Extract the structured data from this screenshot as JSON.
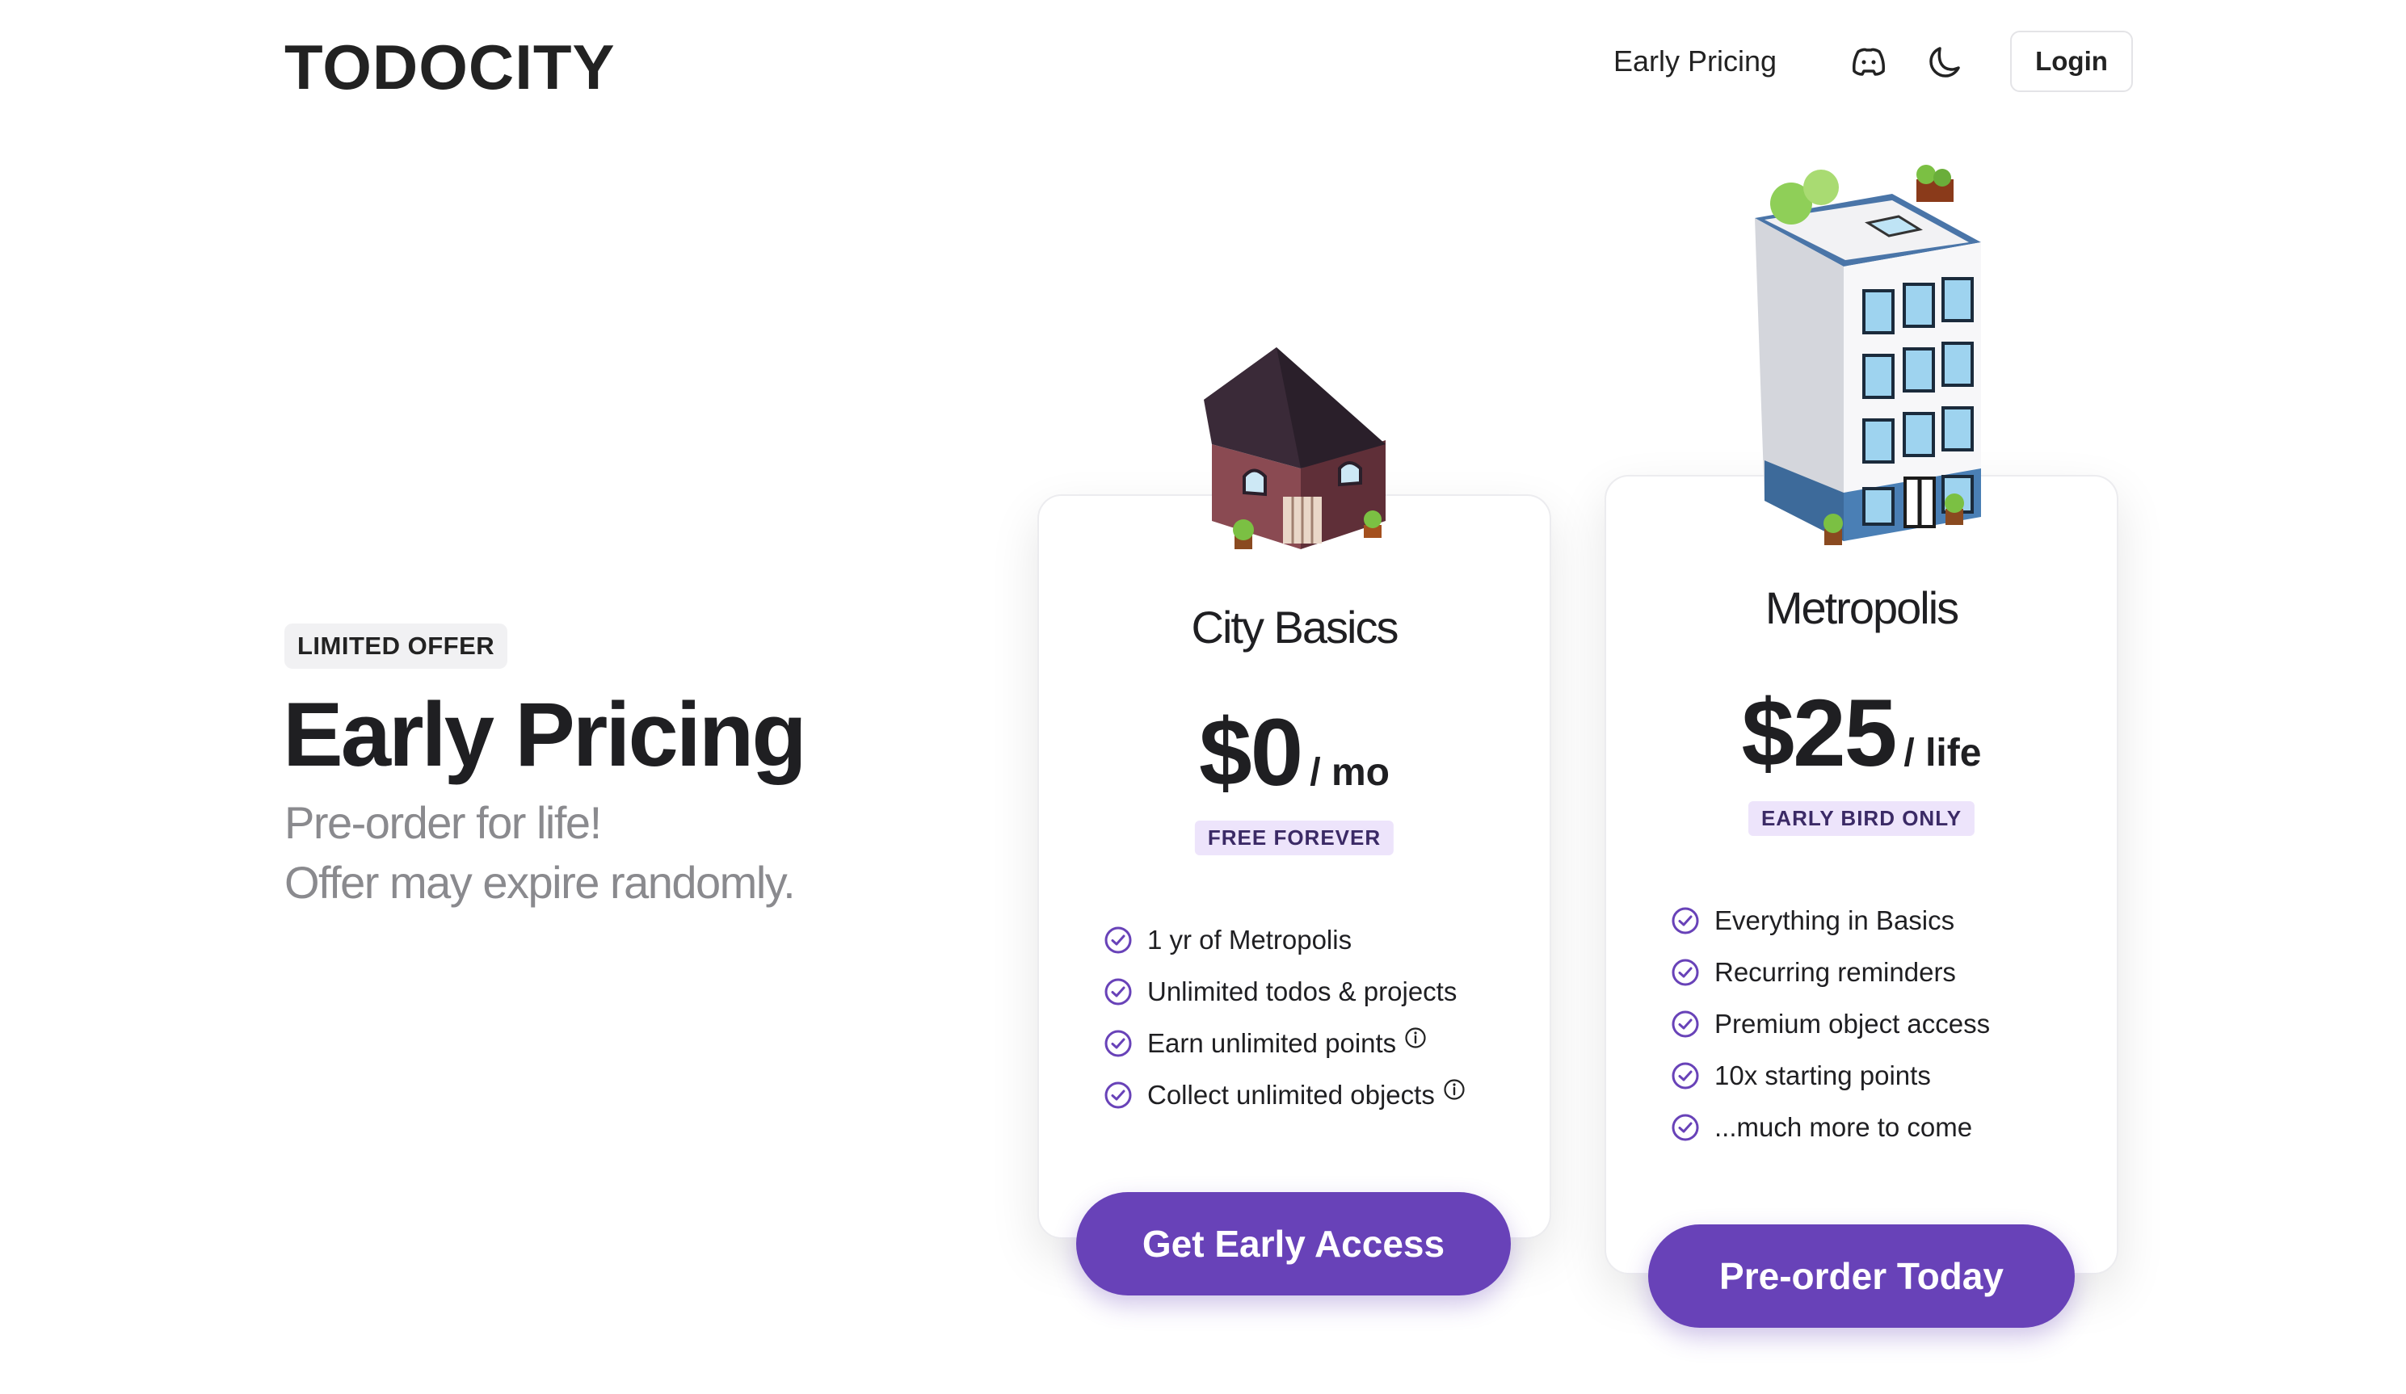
{
  "header": {
    "logo": "TODOCITY",
    "nav_link": "Early Pricing",
    "discord_icon": "discord-icon",
    "theme_icon": "moon-icon",
    "login_label": "Login"
  },
  "hero": {
    "badge": "LIMITED OFFER",
    "title": "Early Pricing",
    "subtitle_line1": "Pre-order for life!",
    "subtitle_line2": "Offer may expire randomly."
  },
  "plans": [
    {
      "name": "City Basics",
      "price": "$0",
      "unit": "/ mo",
      "tag": "FREE FOREVER",
      "features": [
        "1 yr of Metropolis",
        "Unlimited todos & projects",
        "Earn unlimited points",
        "Collect unlimited objects"
      ],
      "cta": "Get Early Access",
      "illustration": "house-icon"
    },
    {
      "name": "Metropolis",
      "price": "$25",
      "unit": "/ life",
      "tag": "EARLY BIRD ONLY",
      "features": [
        "Everything in Basics",
        "Recurring reminders",
        "Premium object access",
        "10x starting points",
        "...much more to come"
      ],
      "cta": "Pre-order Today",
      "illustration": "apartment-building-icon"
    }
  ],
  "colors": {
    "accent": "#6842b8",
    "tag_bg": "#ede4fb",
    "text": "#1f1f22",
    "muted": "#8a8a8e"
  }
}
